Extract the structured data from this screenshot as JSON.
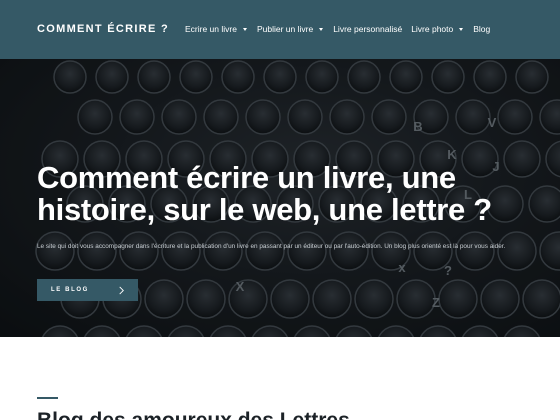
{
  "header": {
    "logo": "COMMENT ÉCRIRE ?",
    "nav": [
      {
        "label": "Ecrire un livre",
        "has_dropdown": true
      },
      {
        "label": "Publier un livre",
        "has_dropdown": true
      },
      {
        "label": "Livre personnalisé",
        "has_dropdown": false
      },
      {
        "label": "Livre photo",
        "has_dropdown": true
      },
      {
        "label": "Blog",
        "has_dropdown": false
      }
    ]
  },
  "hero": {
    "title": "Comment écrire un livre, une histoire, sur le web, une lettre ?",
    "subtitle": "Le site qui doit vous accompagner dans l'écriture et la publication d'un livre en passant par un éditeur ou par l'auto-édition. Un blog plus orienté est là pour vous aider.",
    "button_label": "LE BLOG",
    "keycaps": [
      "V",
      "B",
      "K",
      "J",
      "L",
      "?",
      "x",
      "Z",
      "X"
    ]
  },
  "section": {
    "title": "Blog des amoureux des Lettres"
  },
  "colors": {
    "header_bg": "#355966",
    "accent": "#355966",
    "hero_text": "#ffffff"
  }
}
